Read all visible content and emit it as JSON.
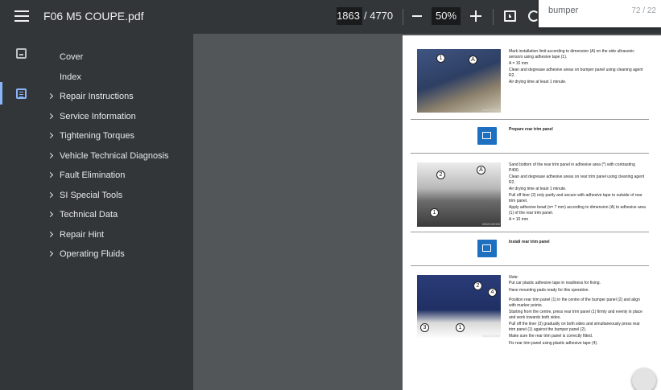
{
  "toolbar": {
    "title": "F06 M5 COUPE.pdf",
    "page_current": "1863",
    "page_total": "/ 4770",
    "zoom": "50%"
  },
  "find": {
    "query": "bumper",
    "count": "72 / 22"
  },
  "outline": [
    {
      "label": "Cover",
      "expandable": false
    },
    {
      "label": "Index",
      "expandable": false
    },
    {
      "label": "Repair Instructions",
      "expandable": true
    },
    {
      "label": "Service Information",
      "expandable": true
    },
    {
      "label": "Tightening Torques",
      "expandable": true
    },
    {
      "label": "Vehicle Technical Diagnosis",
      "expandable": true
    },
    {
      "label": "Fault Elimination",
      "expandable": true
    },
    {
      "label": "SI Special Tools",
      "expandable": true
    },
    {
      "label": "Technical Data",
      "expandable": true
    },
    {
      "label": "Repair Hint",
      "expandable": true
    },
    {
      "label": "Operating Fluids",
      "expandable": true
    }
  ],
  "document": {
    "section1": {
      "lines": [
        "Mark installation limit according to dimension (A) on the side ultrasonic sensors using adhesive tape (1).",
        "A =                                   10 mm",
        "Clean and degrease adhesive areas on bumper panel using cleaning agent R2.",
        "Air drying time at least 1 minute."
      ],
      "image_code": "0052100000"
    },
    "heading2": "Prepare rear trim panel",
    "section2": {
      "lines": [
        "Sand bottom of the rear trim panel in adhesive area (*) with contrasting P400.",
        "Clean and degrease adhesive areas on rear trim panel using cleaning agent R2.",
        "Air drying time at least 1 minute.",
        "Pull off liner (2) only partly and secure with adhesive tape to outside of rear trim panel.",
        "Apply adhesive bead (n= 7 mm) according to dimension (A) to adhesive area (1) of the rear trim panel.",
        "A =                                   10 mm"
      ],
      "image_code": "0052100000"
    },
    "heading3": "Install rear trim panel",
    "section3": {
      "lines": [
        "Note:",
        "Put car plastic adhesive tape in readiness for fixing.",
        "Have mounting pads ready for this operation.",
        "Position rear trim panel (1) in the centre of the bumper panel (2) and align with marker points.",
        "Starting from the centre, press rear trim panel (1) firmly and evenly in place and work towards both sides.",
        "Pull off the liner (3) gradually on both sides and simultaneously press rear trim panel (1) against the bumper panel (2).",
        "Make sure the rear trim panel is correctly fitted.",
        "Fix rear trim panel using plastic adhesive tape (4)."
      ],
      "image_code": "0052100000"
    },
    "callouts": [
      "1",
      "A",
      "1",
      "2",
      "A",
      "1",
      "1",
      "2",
      "3",
      "4",
      "3",
      "1"
    ]
  },
  "icons": [
    "hamburger-menu-icon",
    "zoom-out-icon",
    "zoom-in-icon",
    "fit-page-icon",
    "rotate-icon",
    "thumbnail-view-icon",
    "document-outline-icon",
    "chevron-right-icon",
    "info-icon"
  ]
}
